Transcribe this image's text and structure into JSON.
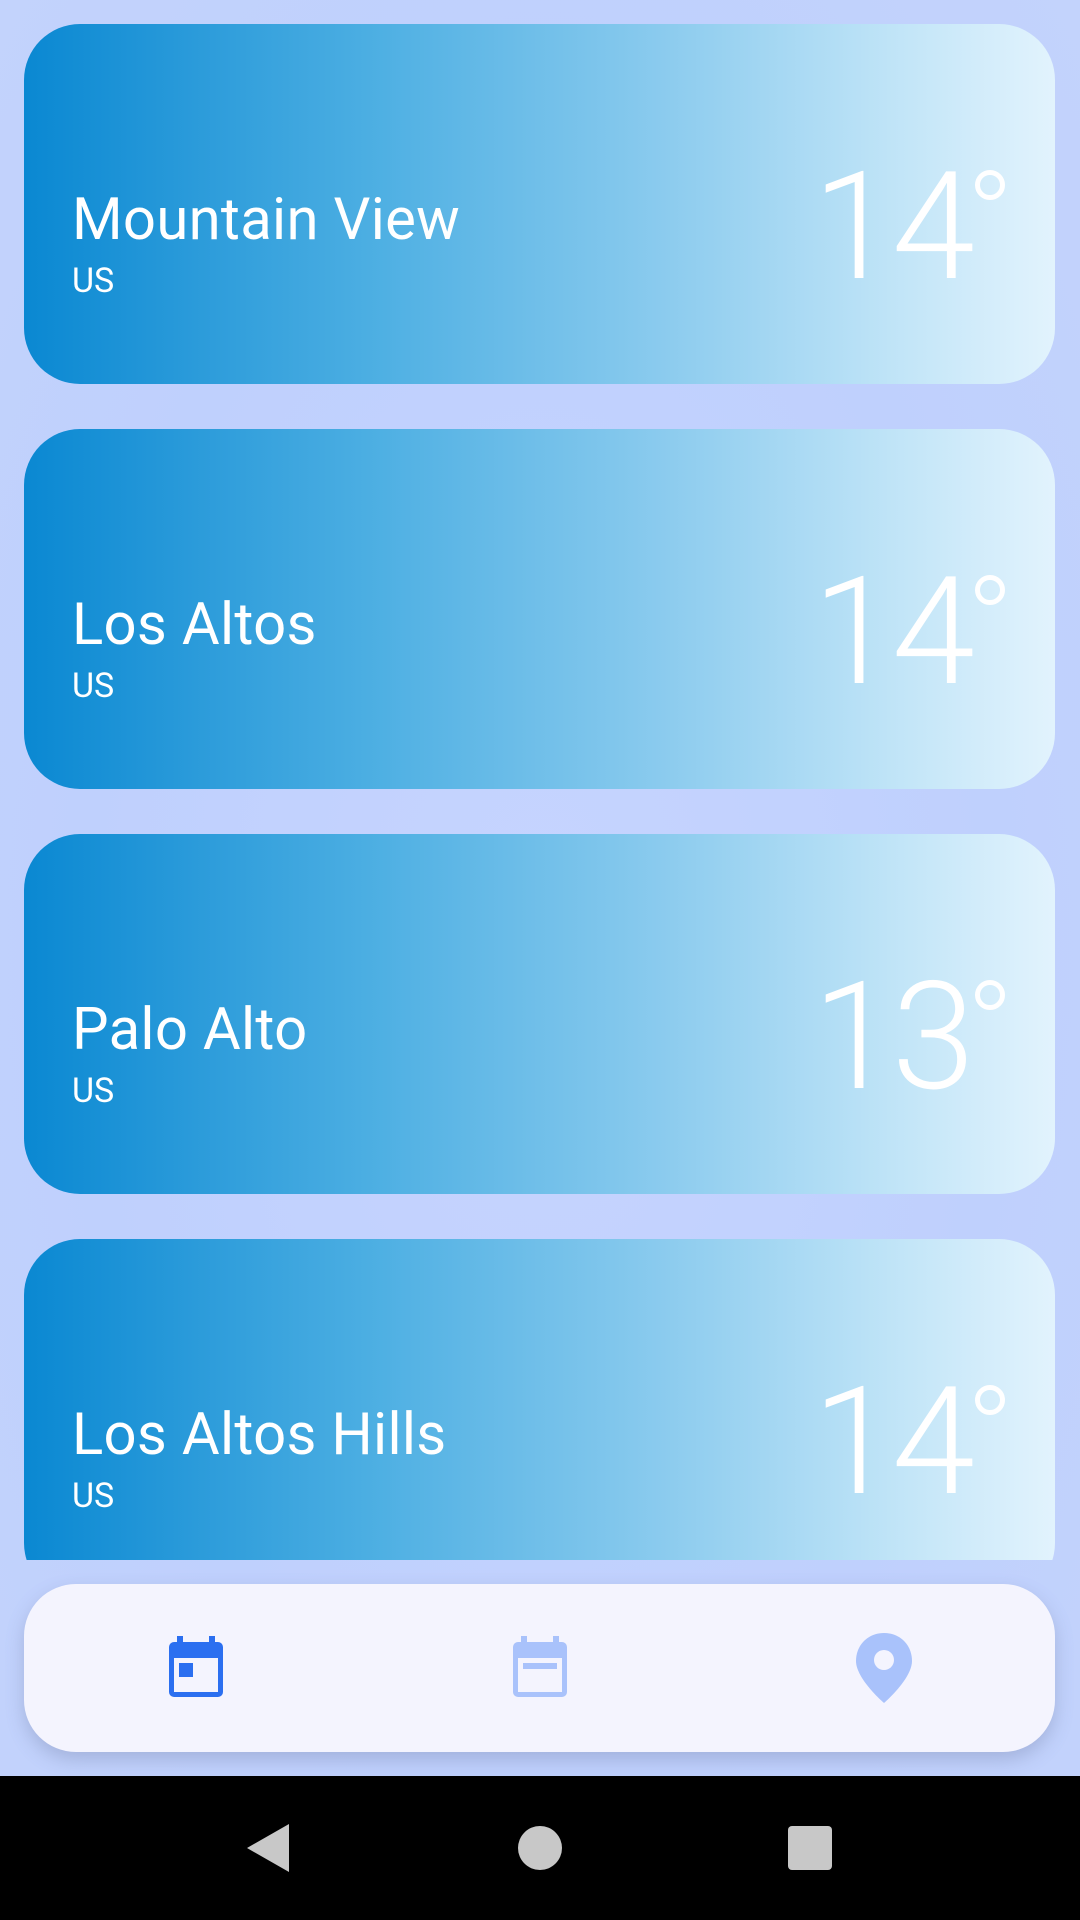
{
  "cities": [
    {
      "name": "Mountain View",
      "country": "US",
      "temp": "14"
    },
    {
      "name": "Los Altos",
      "country": "US",
      "temp": "14"
    },
    {
      "name": "Palo Alto",
      "country": "US",
      "temp": "13"
    },
    {
      "name": "Los Altos Hills",
      "country": "US",
      "temp": "14"
    }
  ],
  "nav": {
    "items": [
      {
        "icon": "calendar-today-icon",
        "active": true
      },
      {
        "icon": "calendar-week-icon",
        "active": false
      },
      {
        "icon": "location-pin-icon",
        "active": false
      }
    ],
    "active_color": "#2b6ff0",
    "inactive_color": "#a9c2fb"
  },
  "system_nav": {
    "icons": [
      "back-icon",
      "home-icon",
      "recents-icon"
    ],
    "color": "#c8c8c8"
  },
  "colors": {
    "background": "#c2d2fd",
    "card_gradient_start": "#0a88d2",
    "card_gradient_end": "#e2f3fd",
    "nav_background": "#f4f4fe"
  }
}
